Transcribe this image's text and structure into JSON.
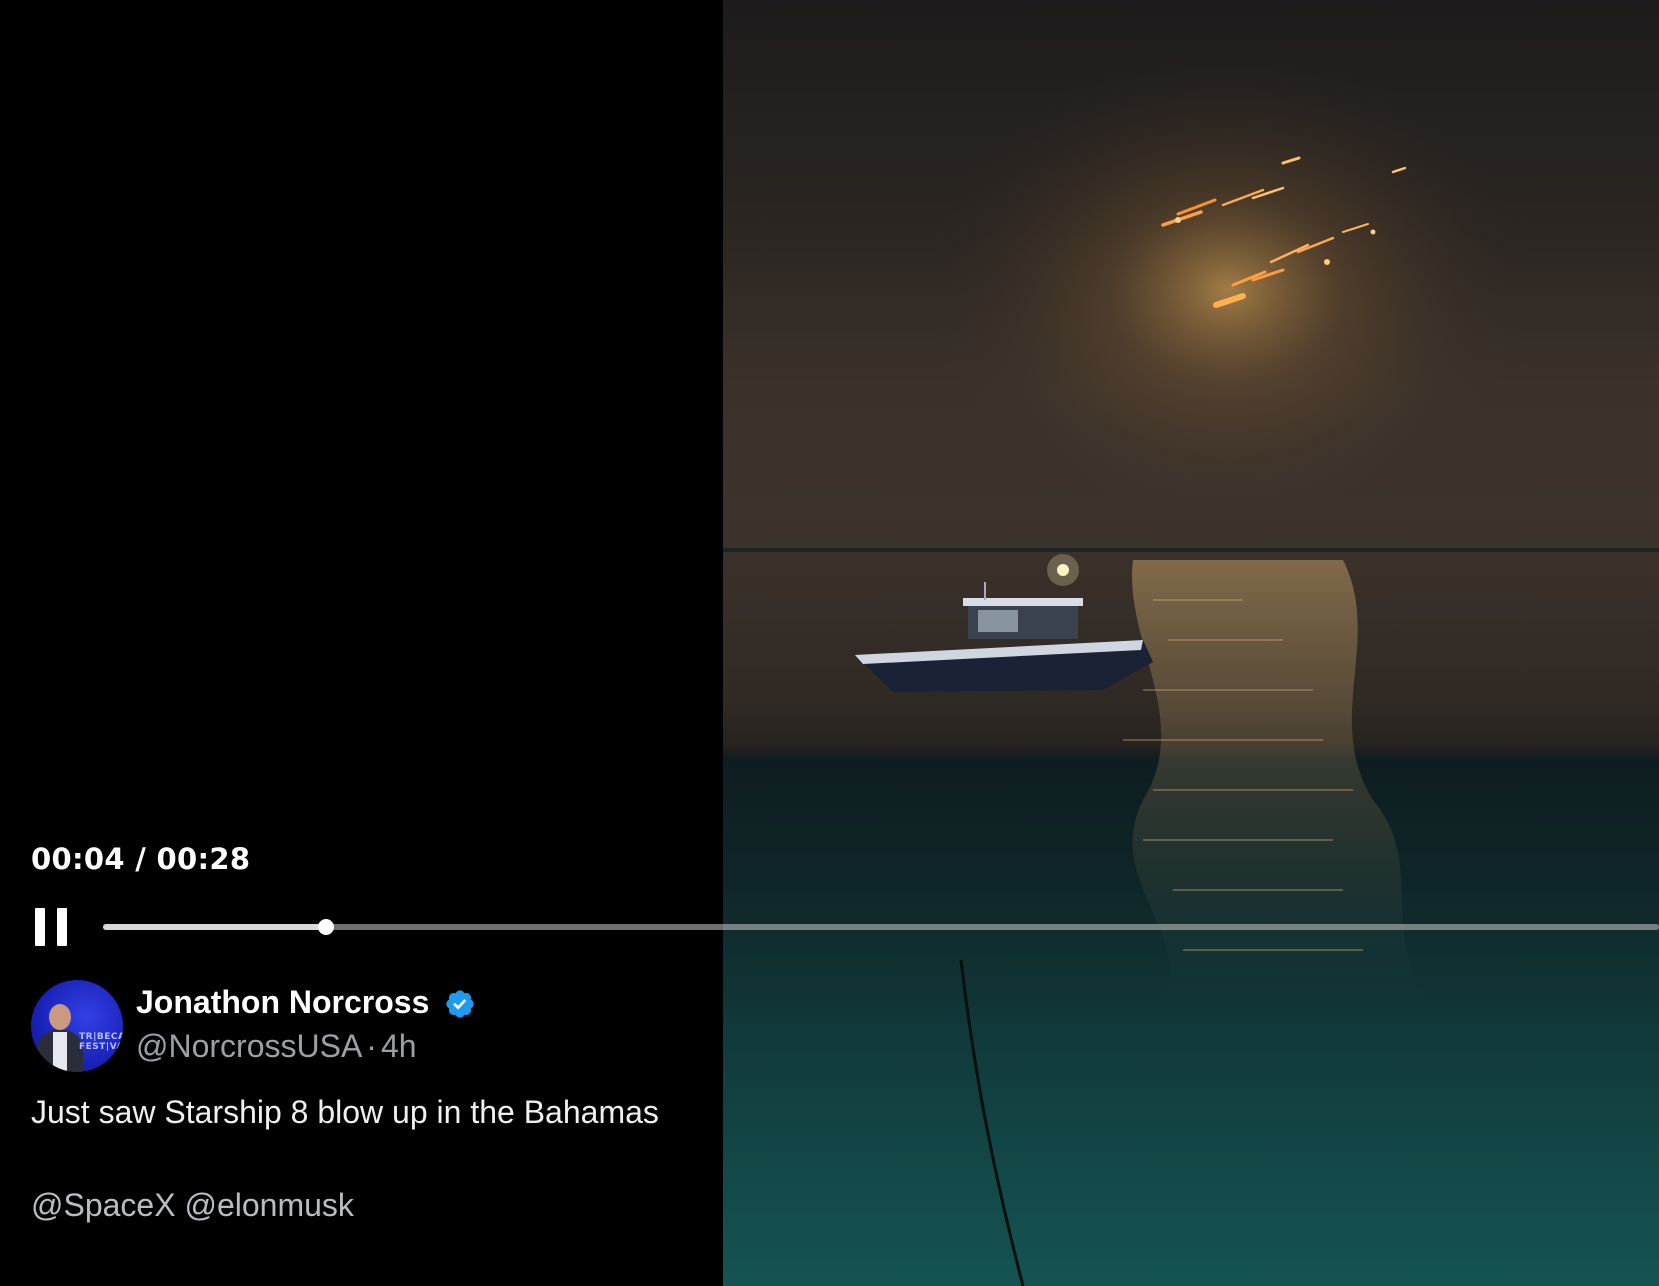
{
  "player": {
    "time_readout": "00:04 / 00:28",
    "progress_fraction": 0.143,
    "state": "playing",
    "pause_icon": "pause-icon"
  },
  "tweet": {
    "display_name": "Jonathon Norcross",
    "verified": true,
    "verified_color": "#1d9bf0",
    "handle": "@NorcrossUSA",
    "separator": "·",
    "age": "4h",
    "text": "Just saw Starship 8 blow up in the Bahamas",
    "mentions": [
      "@SpaceX",
      "@elonmusk"
    ],
    "avatar_banner": [
      "TR|BECA",
      "FEST|VAL"
    ]
  },
  "colors": {
    "background": "#000000",
    "text_primary": "#ffffff",
    "text_secondary": "#9aa0a6",
    "seek_track": "#c8c8c8",
    "sea_teal": "#134a49"
  }
}
